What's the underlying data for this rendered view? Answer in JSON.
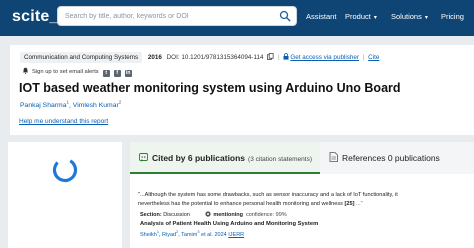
{
  "header": {
    "logo": "scite",
    "logo_suffix": "_",
    "search_placeholder": "Search by title, author, keywords or DOI",
    "nav": [
      {
        "label": "Assistant",
        "has_menu": false
      },
      {
        "label": "Product",
        "has_menu": true
      },
      {
        "label": "Solutions",
        "has_menu": true
      },
      {
        "label": "Pricing",
        "has_menu": false
      }
    ],
    "colors": {
      "nav_bg": "#0f4574",
      "link": "#0a5fb4",
      "accent_green": "#2e7d32"
    }
  },
  "paper": {
    "journal": "Communication and Computing Systems",
    "year": "2016",
    "doi": "DOI: 10.1201/9781315364094-114",
    "access_link": "Get access via publisher",
    "cite_link": "Cite",
    "alert_text": "Sign up to set email alerts",
    "social_icons": [
      "twitter-icon",
      "facebook-icon",
      "linkedin-icon"
    ],
    "title": "IOT based weather monitoring system using Arduino Uno Board",
    "authors": [
      {
        "name": "Pankaj Sharma",
        "sup": "1"
      },
      {
        "name": "Vimlesh Kumar",
        "sup": "2"
      }
    ],
    "help_link": "Help me understand this report"
  },
  "tabs": {
    "cited": {
      "label": "Cited by 6 publications",
      "sub": "(3 citation statements)"
    },
    "references": {
      "label": "References 0 publications"
    }
  },
  "citation": {
    "excerpt": "\"...Although the system has some drawbacks, such as sensor inaccuracy and a lack of IoT functionality, it nevertheless has the potential to enhance personal health monitoring and wellness",
    "ref": "[25]",
    "ellipsis": "...\"",
    "section_label": "Section:",
    "section_value": "Discussion",
    "mention_label": "mentioning",
    "confidence": "confidence: 99%",
    "title": "Analysis of Patient Health Using Arduino and Monitoring System",
    "authors": [
      {
        "name": "Sheikh",
        "sup": "1"
      },
      {
        "name": "Riyad",
        "sup": "2"
      },
      {
        "name": "Tamim",
        "sup": "3"
      }
    ],
    "etal": "et al. 2024",
    "journal": "IJERR"
  }
}
